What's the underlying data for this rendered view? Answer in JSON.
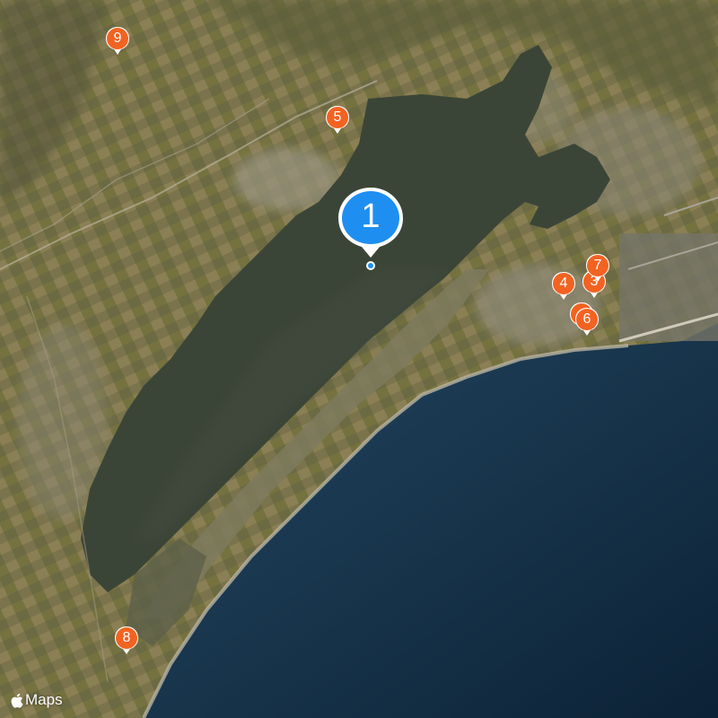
{
  "map": {
    "type": "satellite",
    "attribution": "Maps",
    "colors": {
      "sea_deep": "#0f2a3f",
      "sea_shallow": "#2e4e66",
      "lagoon": "#3c4538",
      "land": "#6f6a44",
      "urban": "#8f8a78",
      "main_pin": "#1e8ff0",
      "pin": "#f26322"
    }
  },
  "pins": [
    {
      "id": "1",
      "label": "1",
      "kind": "primary"
    },
    {
      "id": "4",
      "label": "4",
      "kind": "secondary"
    },
    {
      "id": "5",
      "label": "5",
      "kind": "secondary"
    },
    {
      "id": "3",
      "label": "3",
      "kind": "secondary"
    },
    {
      "id": "6",
      "label": "6",
      "kind": "secondary"
    },
    {
      "id": "7",
      "label": "7",
      "kind": "secondary"
    },
    {
      "id": "8",
      "label": "8",
      "kind": "secondary"
    },
    {
      "id": "9",
      "label": "9",
      "kind": "secondary"
    }
  ]
}
